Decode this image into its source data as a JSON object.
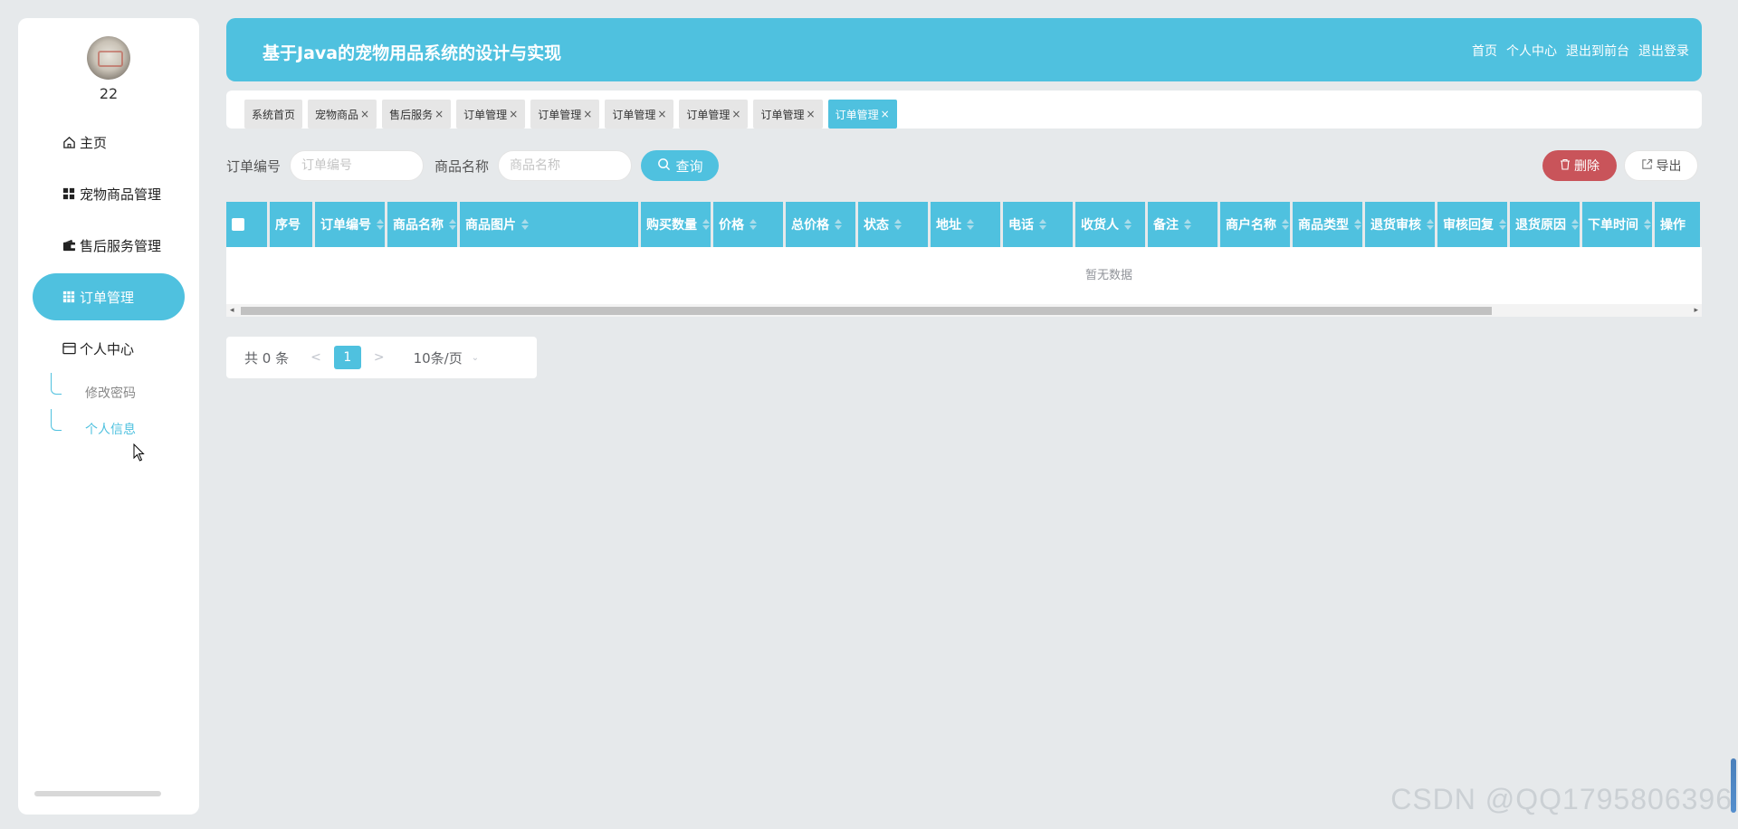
{
  "sidebar": {
    "username": "22",
    "menu": [
      {
        "label": "主页",
        "icon": "home-icon"
      },
      {
        "label": "宠物商品管理",
        "icon": "grid-icon"
      },
      {
        "label": "售后服务管理",
        "icon": "wallet-icon"
      },
      {
        "label": "订单管理",
        "icon": "table-icon"
      },
      {
        "label": "个人中心",
        "icon": "card-icon"
      }
    ],
    "submenu": [
      {
        "label": "修改密码"
      },
      {
        "label": "个人信息"
      }
    ]
  },
  "header": {
    "title": "基于Java的宠物用品系统的设计与实现",
    "nav": [
      "首页",
      "个人中心",
      "退出到前台",
      "退出登录"
    ]
  },
  "tabs": [
    {
      "label": "系统首页"
    },
    {
      "label": "宠物商品"
    },
    {
      "label": "售后服务"
    },
    {
      "label": "订单管理"
    },
    {
      "label": "订单管理"
    },
    {
      "label": "订单管理"
    },
    {
      "label": "订单管理"
    },
    {
      "label": "订单管理"
    },
    {
      "label": "订单管理"
    }
  ],
  "tab_close": "×",
  "search": {
    "order_no_label": "订单编号",
    "order_no_placeholder": "订单编号",
    "product_name_label": "商品名称",
    "product_name_placeholder": "商品名称",
    "query_label": "查询",
    "delete_label": "删除",
    "export_label": "导出"
  },
  "table": {
    "columns": [
      "序号",
      "订单编号",
      "商品名称",
      "商品图片",
      "购买数量",
      "价格",
      "总价格",
      "状态",
      "地址",
      "电话",
      "收货人",
      "备注",
      "商户名称",
      "商品类型",
      "退货审核",
      "审核回复",
      "退货原因",
      "下单时间",
      "操作"
    ],
    "empty_text": "暂无数据"
  },
  "pagination": {
    "total_text": "共 0 条",
    "prev": "<",
    "current_page": "1",
    "next": ">",
    "page_size": "10条/页"
  },
  "watermark": "CSDN @QQ1795806396",
  "colors": {
    "accent": "#4fc1df",
    "danger": "#c9545a",
    "background": "#e6e9eb"
  }
}
